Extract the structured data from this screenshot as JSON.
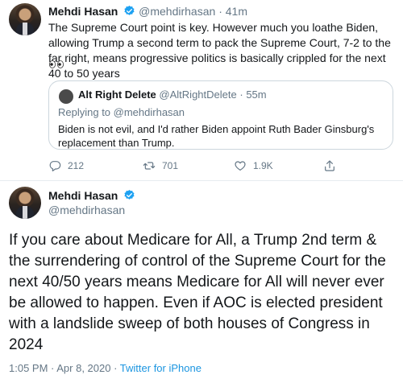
{
  "colors": {
    "verified": "#1da1f2",
    "muted": "#657786",
    "link": "#1b95e0",
    "border": "#ccd6dd"
  },
  "tweet1": {
    "name": "Mehdi Hasan",
    "handle": "@mehdirhasan",
    "separator": "·",
    "time": "41m",
    "text": "The Supreme Court point is key. However much you loathe Biden, allowing Trump a second term to pack the Supreme Court, 7-2 to the far right, means progressive politics is basically crippled for the next 40 to 50 years",
    "emoji_icon": "eyes-emoji",
    "quote": {
      "name": "Alt Right Delete",
      "handle": "@AltRightDelete",
      "separator": "·",
      "time": "55m",
      "replying_to": "Replying to @mehdirhasan",
      "text": "Biden is not evil, and I'd rather Biden appoint Ruth Bader Ginsburg's replacement than Trump."
    },
    "actions": {
      "replies": "212",
      "retweets": "701",
      "likes": "1.9K"
    }
  },
  "tweet2": {
    "name": "Mehdi Hasan",
    "handle": "@mehdirhasan",
    "text": "If you care about Medicare for All, a Trump 2nd term & the surrendering of control of the Supreme Court for the next 40/50 years means Medicare for All will never ever be allowed to happen. Even if AOC is elected president with a landslide sweep of both houses of Congress in 2024",
    "timestamp": "1:05 PM · Apr 8, 2020 · ",
    "source": "Twitter for iPhone"
  }
}
